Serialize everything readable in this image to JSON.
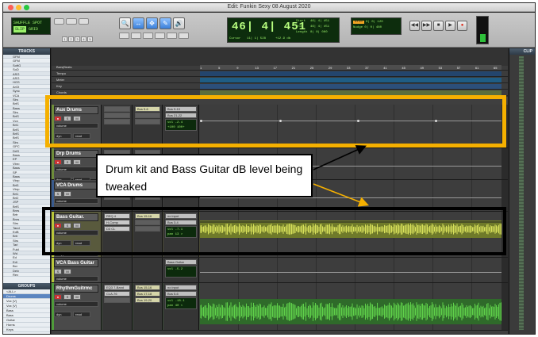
{
  "window": {
    "title": "Edit: Funkin Sexy 08 August 2020"
  },
  "toolbar": {
    "mode_lines": [
      "SHUFFLE",
      "SPOT",
      "SLIP",
      "GRID"
    ],
    "mode_selected": "SLIP",
    "num_buttons": [
      "1",
      "2",
      "3",
      "4",
      "5"
    ],
    "tools": [
      "🔍",
      "↔",
      "✥",
      "✎",
      "🔊"
    ],
    "counter_main": "46| 4| 451",
    "counter_start_label": "Start",
    "counter_start": "46| 4| 451",
    "counter_end_label": "End",
    "counter_end": "46| 4| 451",
    "counter_length_label": "Length",
    "counter_length": "0| 0| 000",
    "cursor_label": "Cursor",
    "cursor_value": "11| 1| 528",
    "db_value": "+12.9 db",
    "grid_label": "Grid",
    "grid_value": "0| 0| 120",
    "nudge_label": "Nudge",
    "nudge_value": "0| 0| 480",
    "transport": [
      "◀◀",
      "▶▶",
      "■",
      "▶",
      "●"
    ]
  },
  "left": {
    "tracks_title": "TRACKS",
    "track_names": [
      "GFM",
      "GFM",
      "SoftG",
      "SoD",
      "ASG",
      "ASG",
      "HGS",
      "ArGt",
      "Sync",
      "VCA",
      "Slrs",
      "BrtS",
      "Bass",
      "Slrs",
      "BrtS",
      "Vcn",
      "Brt1",
      "BrtS",
      "BrtS",
      "BrtS",
      "Slrs",
      "GPC",
      "DrtS",
      "Bass",
      "EP",
      "Vbrp",
      "Bass",
      "SP",
      "Bass",
      "Vbrp",
      "Brt3",
      "Vbrp",
      "Brt1",
      "Brt2",
      "JSP",
      "BrtS",
      "Bnrs",
      "Brtr",
      "Bnrs",
      "Strs",
      "Tapd",
      "EdB",
      "Brtr",
      "Strs",
      "Tarl",
      "Fuld",
      "Wd",
      "Ed",
      "Edi",
      "Bcr",
      "Dely",
      "Rev"
    ],
    "groups_title": "GROUPS",
    "groups": [
      "<ALL>",
      "Drums",
      "Vox (V)",
      "Vox (V)",
      "Bass",
      "Bass",
      "Guitar",
      "Horns",
      "Keys"
    ]
  },
  "right": {
    "clips_title": "CLIP"
  },
  "rulers": {
    "rows": [
      "Bars|Beats",
      "Tempo",
      "Meter",
      "Key",
      "Chords",
      "Markers"
    ],
    "bar_numbers": [
      "1",
      "5",
      "9",
      "13",
      "17",
      "21",
      "25",
      "29",
      "33",
      "37",
      "41",
      "45",
      "49",
      "53",
      "57",
      "61",
      "65"
    ]
  },
  "columns": {
    "inserts": "INSERTS A-E",
    "sends": "SENDS A-E",
    "io": "I / O"
  },
  "tracks": [
    {
      "name": "Aux Drums",
      "color": "#6e8d3a",
      "btn_labels": [
        "●",
        "S",
        "M"
      ],
      "field1": "volume",
      "dyn": "dyn",
      "auto": "read",
      "inserts": [],
      "sends": [
        "Bus 5-6"
      ],
      "io": [
        "Bus 9-10",
        "Bus 21-22"
      ],
      "vol": "vol  -2.4",
      "pan": "+100  100+"
    },
    {
      "name": "Drp Drums",
      "color": "#6e8d3a",
      "btn_labels": [
        "●",
        "S",
        "M"
      ],
      "field1": "volume",
      "dyn": "dyn",
      "auto": "read",
      "inserts": [],
      "sends": [],
      "io": [],
      "vol": "",
      "pan": ""
    },
    {
      "name": "VCA Drums",
      "color": "#3a5b8d",
      "btn_labels": [
        "S",
        "M"
      ],
      "field1": "volume",
      "dyn": "",
      "auto": "",
      "inserts": [],
      "sends": [],
      "io": [],
      "vol": "",
      "pan": ""
    },
    {
      "name": "Bass Guitar.",
      "color": "#b9c73a",
      "btn_labels": [
        "●",
        "S",
        "M"
      ],
      "field1": "volume",
      "dyn": "dyn",
      "auto": "read",
      "extra": "Polyphonic",
      "inserts": [
        "REQ 4",
        "H-Comp",
        "D3 CL"
      ],
      "sends": [
        "Bus 15-16"
      ],
      "io": [
        "no input",
        "Bus 3-4"
      ],
      "vol": "vol  -7.1",
      "pan": "pan  13 >"
    },
    {
      "name": "VCA Bass Guitar",
      "color": "#b9c73a",
      "btn_labels": [
        "S",
        "M"
      ],
      "field1": "volume",
      "dyn": "",
      "auto": "auto read",
      "inserts": [],
      "sends": [],
      "io": [
        "Bass Guitar"
      ],
      "vol": "vol  -5.2",
      "pan": ""
    },
    {
      "name": "RhythmGuitrmc",
      "color": "#4f9c3a",
      "btn_labels": [
        "●",
        "S",
        "M"
      ],
      "field1": "volume",
      "dyn": "dyn",
      "auto": "read",
      "inserts": [
        "EQ3 7-Band",
        "CLA-76"
      ],
      "sends": [
        "Bus 15-16",
        "Bus 17-18",
        "Bus 19-20"
      ],
      "io": [
        "no input",
        "Bus 5-6"
      ],
      "vol": "vol  -18.1",
      "pan": "pan  40 <"
    }
  ],
  "annotation": {
    "callout": "Drum kit and Bass Guitar dB level being tweaked",
    "yellow_color": "#f5b000",
    "black_color": "#000000"
  }
}
